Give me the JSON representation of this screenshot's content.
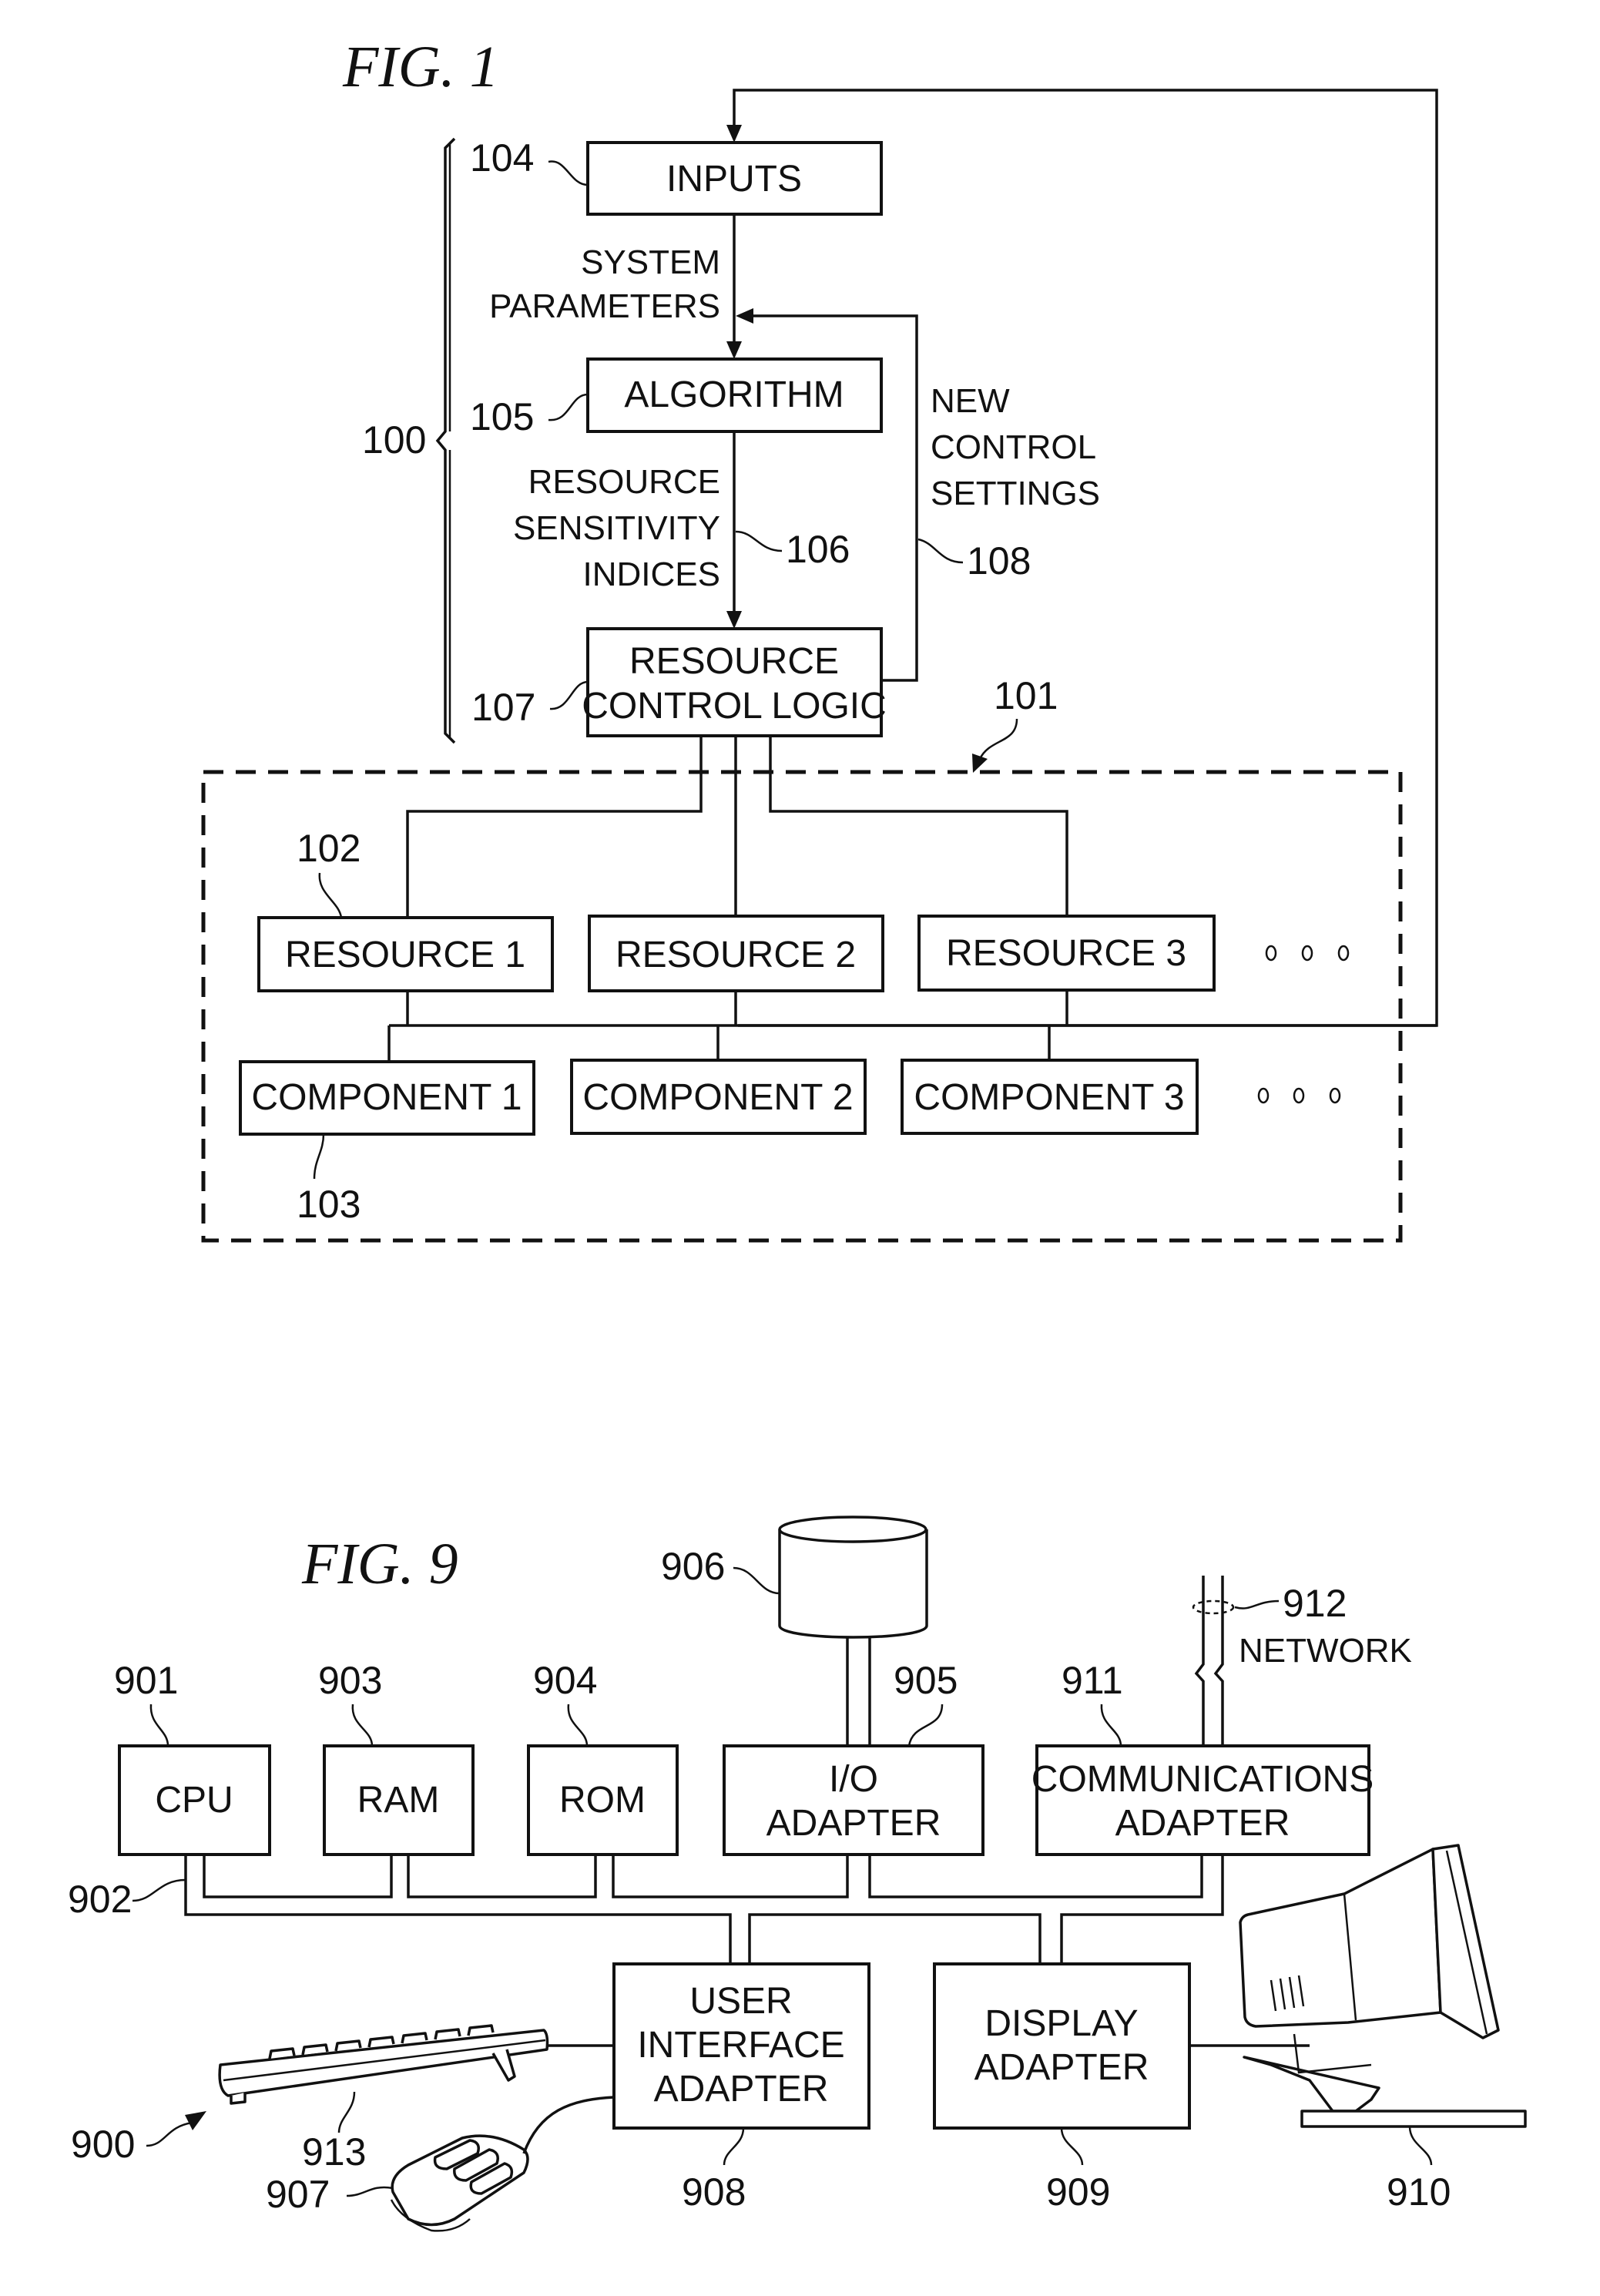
{
  "fig1": {
    "title": "FIG. 1",
    "boxes": {
      "inputs": "INPUTS",
      "algorithm": "ALGORITHM",
      "rcl_line1": "RESOURCE",
      "rcl_line2": "CONTROL LOGIC"
    },
    "labels": {
      "system_parameters": [
        "SYSTEM",
        "PARAMETERS"
      ],
      "sensitivity": [
        "RESOURCE",
        "SENSITIVITY",
        "INDICES"
      ],
      "new_control": [
        "NEW",
        "CONTROL",
        "SETTINGS"
      ]
    },
    "resources": [
      "RESOURCE 1",
      "RESOURCE 2",
      "RESOURCE 3"
    ],
    "components": [
      "COMPONENT 1",
      "COMPONENT 2",
      "COMPONENT 3"
    ],
    "ellipsis": "ooo",
    "refs": {
      "r100": "100",
      "r101": "101",
      "r102": "102",
      "r103": "103",
      "r104": "104",
      "r105": "105",
      "r106": "106",
      "r107": "107",
      "r108": "108"
    }
  },
  "fig9": {
    "title": "FIG. 9",
    "boxes": {
      "cpu": "CPU",
      "ram": "RAM",
      "rom": "ROM",
      "io": [
        "I/O",
        "ADAPTER"
      ],
      "comm": [
        "COMMUNICATIONS",
        "ADAPTER"
      ],
      "uia": [
        "USER",
        "INTERFACE",
        "ADAPTER"
      ],
      "display": [
        "DISPLAY",
        "ADAPTER"
      ]
    },
    "network_label": "NETWORK",
    "refs": {
      "r900": "900",
      "r901": "901",
      "r902": "902",
      "r903": "903",
      "r904": "904",
      "r905": "905",
      "r906": "906",
      "r907": "907",
      "r908": "908",
      "r909": "909",
      "r910": "910",
      "r911": "911",
      "r912": "912",
      "r913": "913"
    }
  }
}
